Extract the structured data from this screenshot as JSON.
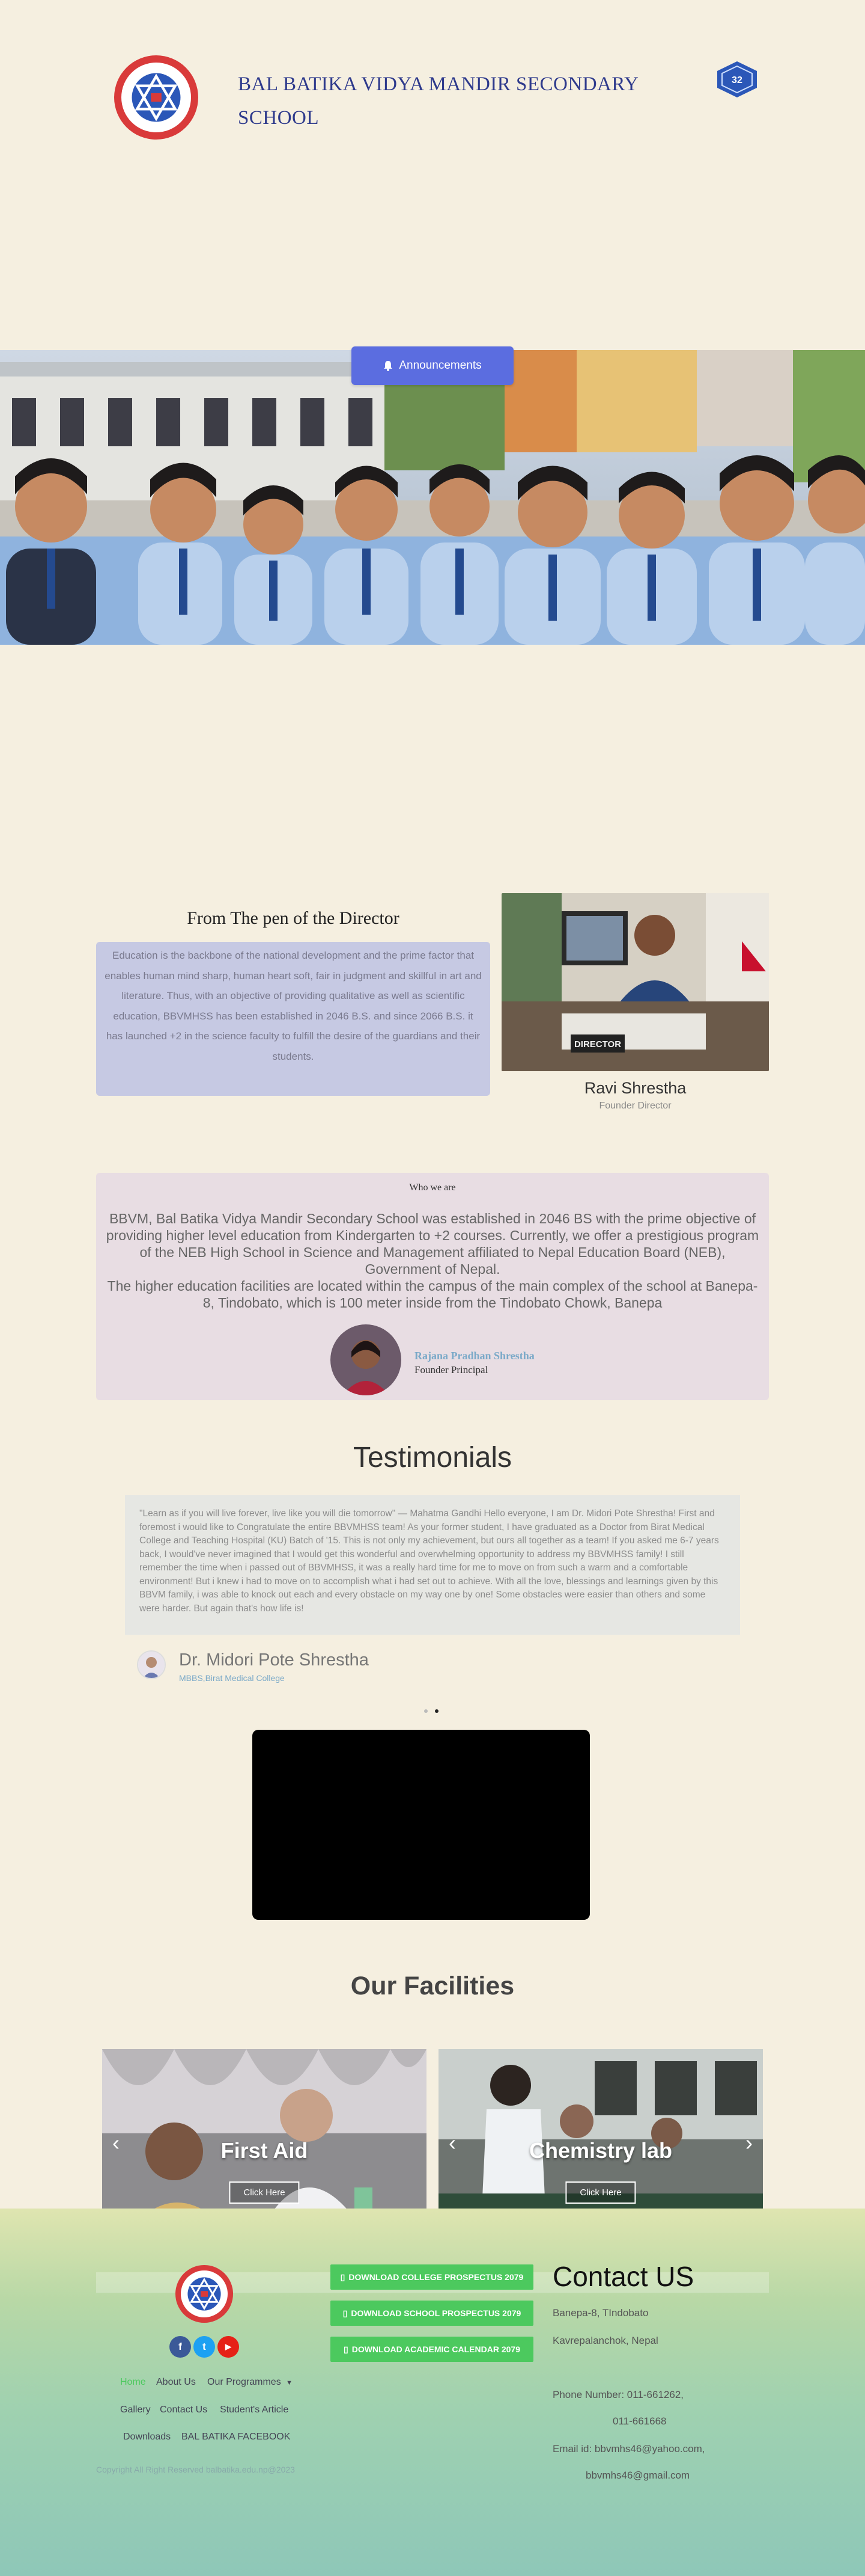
{
  "header": {
    "school_name": "BAL BATIKA VIDYA MANDIR SECONDARY SCHOOL",
    "logo_icon": "school-emblem-icon",
    "anniversary_icon": "anniversary-32-badge-icon"
  },
  "hero": {
    "announcement_label": "Announcements",
    "sign_text": "DIRECTOR"
  },
  "director": {
    "title": "From The pen of the Director",
    "message": "Education is the backbone of the national development and the prime factor that enables human mind sharp, human heart soft, fair in judgment and skillful in art and literature. Thus, with an objective of providing qualitative as well as scientific education, BBVMHSS has been established in 2046 B.S. and since 2066 B.S. it has launched +2 in the science faculty to fulfill the desire of the guardians and their students.",
    "name": "Ravi Shrestha",
    "role": "Founder Director"
  },
  "who": {
    "label": "Who we are",
    "paragraph1": "BBVM, Bal Batika Vidya Mandir Secondary School was established in 2046 BS with the prime objective of providing higher level education from Kindergarten to +2 courses. Currently, we offer a prestigious program of the NEB High School in Science and Management affiliated to Nepal Education Board (NEB), Government of Nepal.",
    "paragraph2": "The higher education facilities are located within the campus of the main complex of the school at Banepa-8, Tindobato, which is 100 meter inside from the Tindobato Chowk, Banepa",
    "principal_name": "Rajana Pradhan Shrestha",
    "principal_role": "Founder Principal"
  },
  "testimonials": {
    "title": "Testimonials",
    "quote": "\"Learn as if you will live forever, live like you will die tomorrow\" — Mahatma Gandhi Hello everyone, I am Dr. Midori Pote Shrestha! First and foremost i would like to Congratulate the entire BBVMHSS team! As your former student, I have graduated as a Doctor from Birat Medical College and Teaching Hospital (KU) Batch of '15. This is not only my achievement, but ours all together as a team! If you asked me 6-7 years back, I would've never imagined that I would get this wonderful and overwhelming opportunity to address my BBVMHSS family! I still remember the time when i passed out of BBVMHSS, it was a really hard time for me to move on from such a warm and a comfortable environment! But i knew i had to move on to accomplish what i had set out to achieve. With all the love, blessings and learnings given by this BBVM family, i was able to knock out each and every obstacle on my way one by one! Some obstacles were easier than others and some were harder. But again that's how life is!",
    "author": "Dr. Midori Pote Shrestha",
    "author_sub": "MBBS,Birat Medical College"
  },
  "facilities": {
    "title": "Our Facilities",
    "cards": [
      {
        "label": "First Aid",
        "button": "Click Here"
      },
      {
        "label": "Chemistry lab",
        "button": "Click Here"
      }
    ]
  },
  "footer": {
    "social": [
      {
        "icon": "facebook-icon",
        "glyph": "f",
        "color": "#3b5998"
      },
      {
        "icon": "twitter-icon",
        "glyph": "t",
        "color": "#1da1f2"
      },
      {
        "icon": "youtube-icon",
        "glyph": "▶",
        "color": "#e62117"
      }
    ],
    "nav": {
      "home": "Home",
      "about": "About Us",
      "programmes": "Our Programmes",
      "gallery": "Gallery",
      "contact": "Contact Us",
      "articles": "Student's Article",
      "downloads": "Downloads",
      "facebook": "BAL BATIKA FACEBOOK"
    },
    "downloads": {
      "college": "DOWNLOAD COLLEGE PROSPECTUS 2079",
      "school": "DOWNLOAD SCHOOL PROSPECTUS 2079",
      "calendar": "DOWNLOAD ACADEMIC CALENDAR 2079"
    },
    "contact": {
      "title": "Contact US",
      "address1": "Banepa-8, TIndobato",
      "address2": "Kavrepalanchok, Nepal",
      "phone": "Phone Number: 011-661262,",
      "phone2": "011-661668",
      "email": "Email id: bbvmhs46@yahoo.com,",
      "email2": "bbvmhs46@gmail.com"
    },
    "copyright": "Copyright All Right Reserved balbatika.edu.np@2023"
  },
  "colors": {
    "background": "#f5efe0",
    "school_name": "#2e3a8c",
    "announce_button": "#5b6de0",
    "director_box": "#c6c9e3",
    "who_box": "#e8dde3",
    "download_button": "#4cc95e",
    "nav_active": "#4cc95e"
  }
}
